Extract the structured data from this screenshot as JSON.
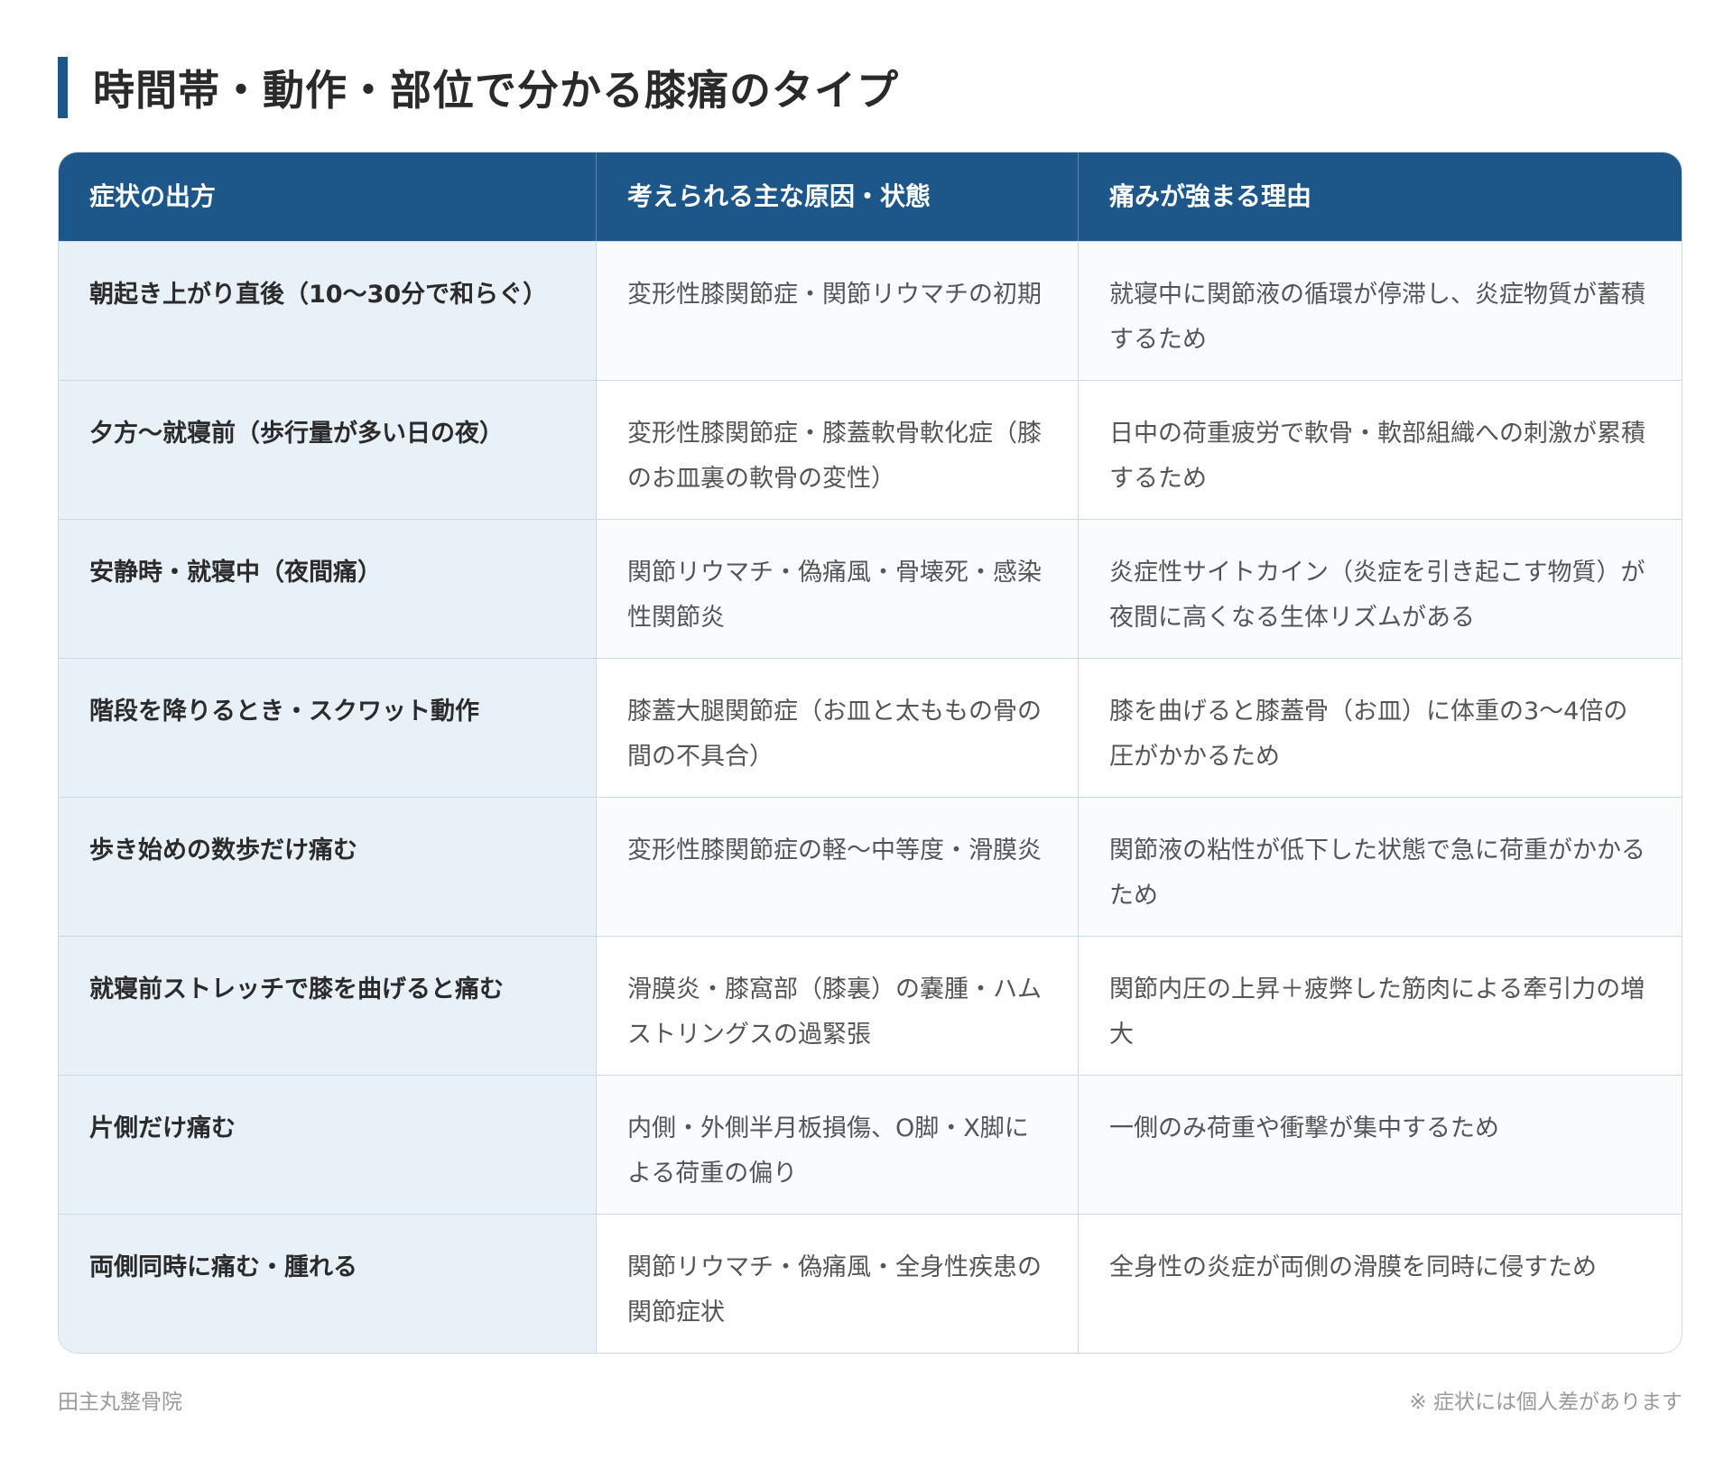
{
  "title": "時間帯・動作・部位で分かる膝痛のタイプ",
  "table": {
    "headers": [
      "症状の出方",
      "考えられる主な原因・状態",
      "痛みが強まる理由"
    ],
    "rows": [
      [
        "朝起き上がり直後（10〜30分で和らぐ）",
        "変形性膝関節症・関節リウマチの初期",
        "就寝中に関節液の循環が停滞し、炎症物質が蓄積するため"
      ],
      [
        "夕方〜就寝前（歩行量が多い日の夜）",
        "変形性膝関節症・膝蓋軟骨軟化症（膝のお皿裏の軟骨の変性）",
        "日中の荷重疲労で軟骨・軟部組織への刺激が累積するため"
      ],
      [
        "安静時・就寝中（夜間痛）",
        "関節リウマチ・偽痛風・骨壊死・感染性関節炎",
        "炎症性サイトカイン（炎症を引き起こす物質）が夜間に高くなる生体リズムがある"
      ],
      [
        "階段を降りるとき・スクワット動作",
        "膝蓋大腿関節症（お皿と太ももの骨の間の不具合）",
        "膝を曲げると膝蓋骨（お皿）に体重の3〜4倍の圧がかかるため"
      ],
      [
        "歩き始めの数歩だけ痛む",
        "変形性膝関節症の軽〜中等度・滑膜炎",
        "関節液の粘性が低下した状態で急に荷重がかかるため"
      ],
      [
        "就寝前ストレッチで膝を曲げると痛む",
        "滑膜炎・膝窩部（膝裏）の嚢腫・ハムストリングスの過緊張",
        "関節内圧の上昇＋疲弊した筋肉による牽引力の増大"
      ],
      [
        "片側だけ痛む",
        "内側・外側半月板損傷、O脚・X脚による荷重の偏り",
        "一側のみ荷重や衝撃が集中するため"
      ],
      [
        "両側同時に痛む・腫れる",
        "関節リウマチ・偽痛風・全身性疾患の関節症状",
        "全身性の炎症が両側の滑膜を同時に侵すため"
      ]
    ]
  },
  "footer": {
    "left": "田主丸整骨院",
    "right": "※ 症状には個人差があります"
  },
  "colors": {
    "accent": "#1d5688",
    "first_col_bg": "#e9f1f8",
    "border": "#c9dbe8"
  }
}
